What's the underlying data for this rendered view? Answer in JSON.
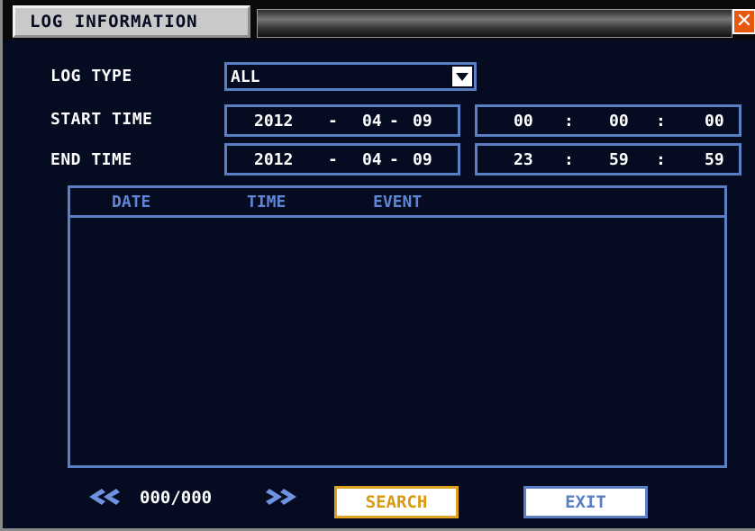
{
  "title": "LOG INFORMATION",
  "close_label": "✕",
  "form": {
    "log_type_label": "LOG TYPE",
    "log_type_value": "ALL",
    "start_label": "START TIME",
    "end_label": "END TIME",
    "start": {
      "year": "2012",
      "month": "04",
      "day": "09",
      "hour": "00",
      "minute": "00",
      "second": "00"
    },
    "end": {
      "year": "2012",
      "month": "04",
      "day": "09",
      "hour": "23",
      "minute": "59",
      "second": "59"
    },
    "date_sep": "-",
    "time_sep": ":"
  },
  "table": {
    "columns": [
      "DATE",
      "TIME",
      "EVENT"
    ],
    "rows": []
  },
  "pager": {
    "count": "000/000"
  },
  "buttons": {
    "search": "SEARCH",
    "exit": "EXIT"
  },
  "colors": {
    "background": "#050c22",
    "border": "#5a7fc2",
    "header_text": "#5f86d6",
    "search": "#d89a10",
    "close": "#e65a10"
  },
  "icons": {
    "prev": "double-chevron-left-icon",
    "next": "double-chevron-right-icon",
    "dropdown": "triangle-down-icon",
    "close": "close-icon"
  }
}
